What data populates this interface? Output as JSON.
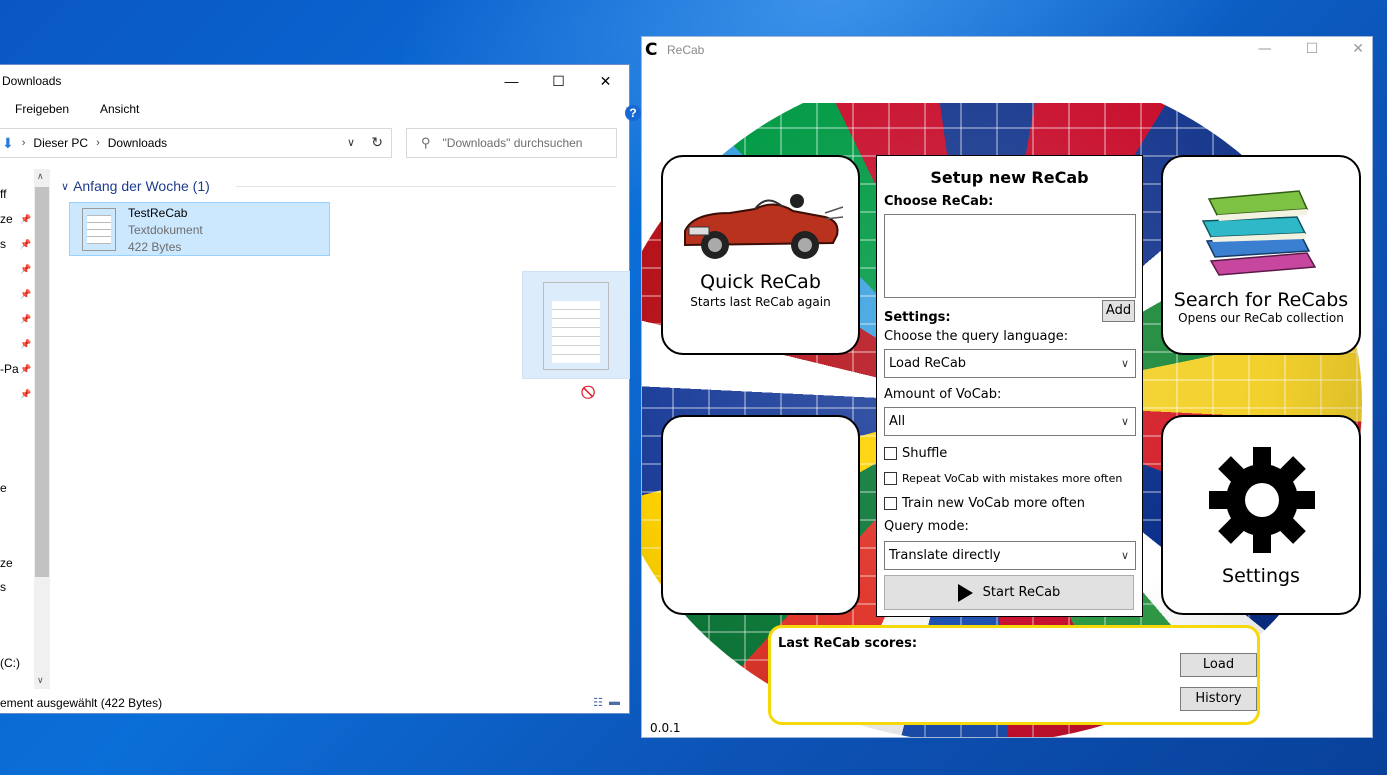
{
  "explorer": {
    "title": "Downloads",
    "ribbon": [
      "Freigeben",
      "Ansicht"
    ],
    "address": [
      "Dieser PC",
      "Downloads"
    ],
    "search_placeholder": "\"Downloads\" durchsuchen",
    "nav_items": [
      "ff",
      "ze",
      "s",
      "",
      "",
      "",
      "",
      "-Pa",
      "",
      "e",
      "ze",
      "s",
      "(C:)"
    ],
    "group_header": "Anfang der Woche (1)",
    "file": {
      "name": "TestReCab",
      "type": "Textdokument",
      "size": "422 Bytes"
    },
    "status": "ement ausgewählt (422 Bytes)"
  },
  "recab": {
    "title": "ReCab",
    "quick": {
      "title": "Quick ReCab",
      "subtitle": "Starts last ReCab again"
    },
    "search": {
      "title": "Search for ReCabs",
      "subtitle": "Opens our ReCab collection"
    },
    "settings_tile": {
      "title": "Settings"
    },
    "setup": {
      "title": "Setup new ReCab",
      "choose_label": "Choose ReCab:",
      "add_label": "Add",
      "settings_label": "Settings:",
      "language_label": "Choose the query language:",
      "language_value": "Load ReCab",
      "amount_label": "Amount of VoCab:",
      "amount_value": "All",
      "shuffle_label": "Shuffle",
      "repeat_label": "Repeat VoCab with mistakes more often",
      "train_label": "Train new VoCab more often",
      "mode_label": "Query mode:",
      "mode_value": "Translate directly",
      "start_label": "Start ReCab"
    },
    "scores": {
      "label": "Last ReCab scores:",
      "load_label": "Load",
      "history_label": "History"
    },
    "version": "0.0.1"
  }
}
